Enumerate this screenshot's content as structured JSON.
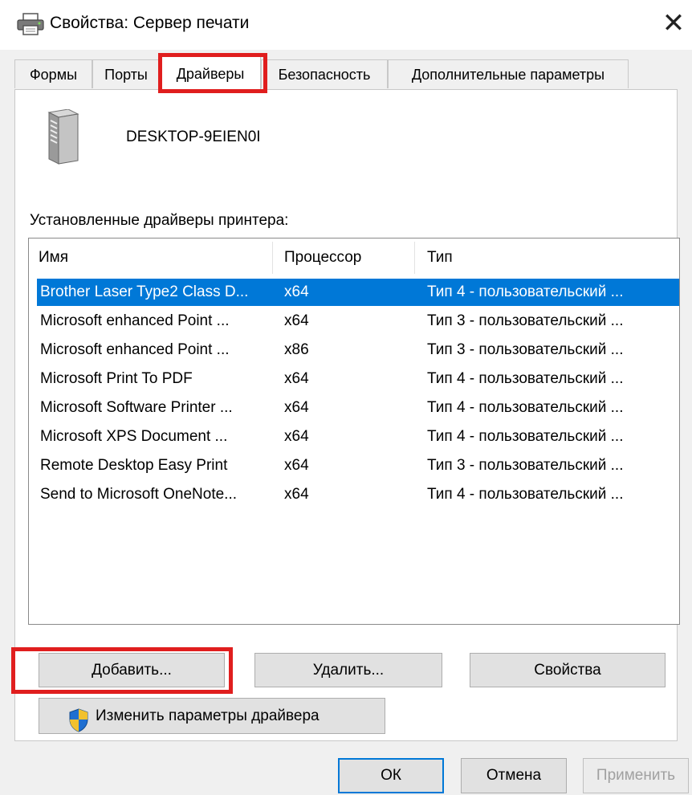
{
  "window": {
    "title": "Свойства: Сервер печати",
    "close_glyph": "✕",
    "title_icon": "printer-icon"
  },
  "tabs": [
    {
      "label": "Формы",
      "active": false
    },
    {
      "label": "Порты",
      "active": false
    },
    {
      "label": "Драйверы",
      "active": true
    },
    {
      "label": "Безопасность",
      "active": false
    },
    {
      "label": "Дополнительные параметры",
      "active": false
    }
  ],
  "server": {
    "name": "DESKTOP-9EIEN0I",
    "icon": "server-tower-icon"
  },
  "drivers": {
    "label": "Установленные драйверы принтера:",
    "columns": [
      "Имя",
      "Процессор",
      "Тип"
    ],
    "rows": [
      {
        "name": "Brother Laser Type2 Class D...",
        "processor": "x64",
        "type": "Тип 4 - пользовательский ...",
        "selected": true
      },
      {
        "name": "Microsoft enhanced Point ...",
        "processor": "x64",
        "type": "Тип 3 - пользовательский ...",
        "selected": false
      },
      {
        "name": "Microsoft enhanced Point ...",
        "processor": "x86",
        "type": "Тип 3 - пользовательский ...",
        "selected": false
      },
      {
        "name": "Microsoft Print To PDF",
        "processor": "x64",
        "type": "Тип 4 - пользовательский ...",
        "selected": false
      },
      {
        "name": "Microsoft Software Printer ...",
        "processor": "x64",
        "type": "Тип 4 - пользовательский ...",
        "selected": false
      },
      {
        "name": "Microsoft XPS Document ...",
        "processor": "x64",
        "type": "Тип 4 - пользовательский ...",
        "selected": false
      },
      {
        "name": "Remote Desktop Easy Print",
        "processor": "x64",
        "type": "Тип 3 - пользовательский ...",
        "selected": false
      },
      {
        "name": "Send to Microsoft OneNote...",
        "processor": "x64",
        "type": "Тип 4 - пользовательский ...",
        "selected": false
      }
    ]
  },
  "buttons": {
    "add": "Добавить...",
    "remove": "Удалить...",
    "properties": "Свойства",
    "change_settings": "Изменить параметры драйвера",
    "ok": "ОК",
    "cancel": "Отмена",
    "apply": "Применить"
  },
  "colors": {
    "selection": "#0078d7",
    "highlight_frame": "#e01e1e",
    "window_bg": "#f0f0f0"
  }
}
